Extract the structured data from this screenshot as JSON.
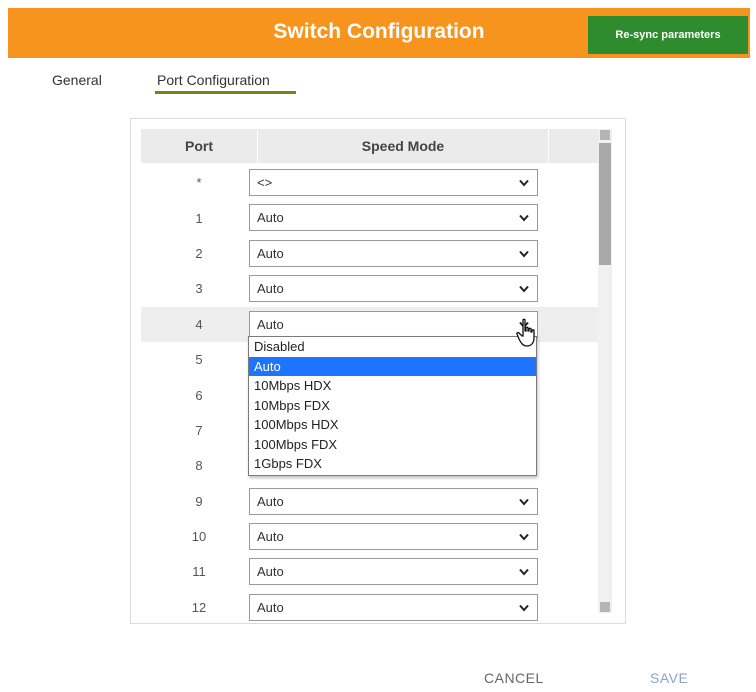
{
  "header": {
    "title": "Switch Configuration",
    "resync_label": "Re-sync parameters"
  },
  "tabs": [
    {
      "label": "General",
      "active": false
    },
    {
      "label": "Port Configuration",
      "active": true
    }
  ],
  "table": {
    "columns": [
      "Port",
      "Speed Mode"
    ],
    "rows": [
      {
        "port": "*",
        "speed": "<>"
      },
      {
        "port": "1",
        "speed": "Auto"
      },
      {
        "port": "2",
        "speed": "Auto"
      },
      {
        "port": "3",
        "speed": "Auto"
      },
      {
        "port": "4",
        "speed": "Auto"
      },
      {
        "port": "5",
        "speed": ""
      },
      {
        "port": "6",
        "speed": ""
      },
      {
        "port": "7",
        "speed": ""
      },
      {
        "port": "8",
        "speed": ""
      },
      {
        "port": "9",
        "speed": "Auto"
      },
      {
        "port": "10",
        "speed": "Auto"
      },
      {
        "port": "11",
        "speed": "Auto"
      },
      {
        "port": "12",
        "speed": "Auto"
      }
    ]
  },
  "dropdown": {
    "options": [
      "Disabled",
      "Auto",
      "10Mbps HDX",
      "10Mbps FDX",
      "100Mbps HDX",
      "100Mbps FDX",
      "1Gbps FDX"
    ],
    "selected": "Auto"
  },
  "footer": {
    "cancel_label": "CANCEL",
    "save_label": "SAVE"
  },
  "colors": {
    "header": "#f7941d",
    "resync": "#2e8b2e",
    "tab_underline": "#6a8a1a",
    "selection": "#1e74ff"
  },
  "icons": {
    "select_arrow": "chevron-down-icon",
    "cursor": "hand-pointer-icon"
  }
}
